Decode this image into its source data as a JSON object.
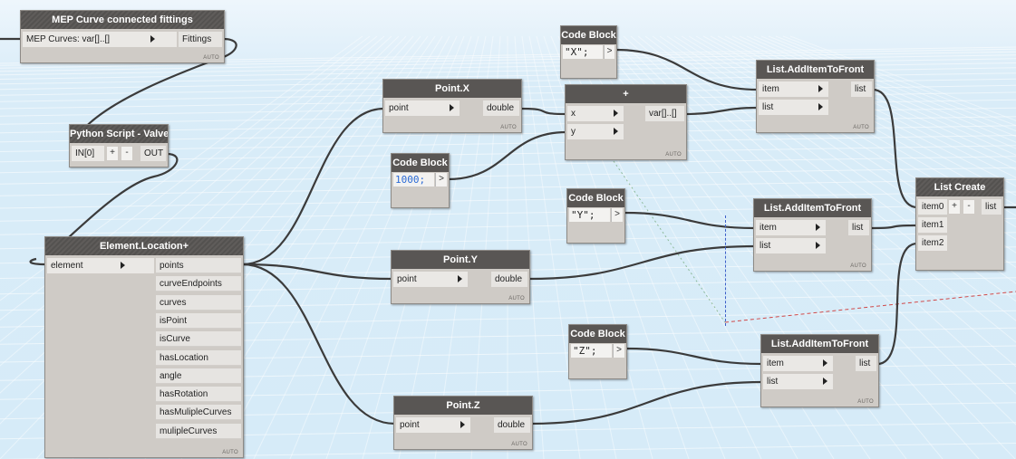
{
  "nodes": {
    "mep": {
      "title": "MEP Curve connected fittings",
      "input": "MEP Curves: var[]..[]",
      "output": "Fittings",
      "lacing": "AUTO"
    },
    "python": {
      "title": "Python Script - Valve",
      "input": "IN[0]",
      "plus": "+",
      "minus": "-",
      "output": "OUT"
    },
    "location": {
      "title": "Element.Location+",
      "input": "element",
      "outputs": [
        "points",
        "curveEndpoints",
        "curves",
        "isPoint",
        "isCurve",
        "hasLocation",
        "angle",
        "hasRotation",
        "hasMulipleCurves",
        "mulipleCurves"
      ],
      "lacing": "AUTO"
    },
    "pointx": {
      "title": "Point.X",
      "input": "point",
      "output": "double",
      "lacing": "AUTO"
    },
    "pointy": {
      "title": "Point.Y",
      "input": "point",
      "output": "double",
      "lacing": "AUTO"
    },
    "pointz": {
      "title": "Point.Z",
      "input": "point",
      "output": "double",
      "lacing": "AUTO"
    },
    "cb_x": {
      "title": "Code Block",
      "code": "\"X\";",
      "out": ">"
    },
    "cb_1000": {
      "title": "Code Block",
      "code": "1000;",
      "out": ">"
    },
    "cb_y": {
      "title": "Code Block",
      "code": "\"Y\";",
      "out": ">"
    },
    "cb_z": {
      "title": "Code Block",
      "code": "\"Z\";",
      "out": ">"
    },
    "plus": {
      "title": "+",
      "inputs": [
        "x",
        "y"
      ],
      "output": "var[]..[]",
      "lacing": "AUTO"
    },
    "add1": {
      "title": "List.AddItemToFront",
      "inputs": [
        "item",
        "list"
      ],
      "output": "list",
      "lacing": "AUTO"
    },
    "add2": {
      "title": "List.AddItemToFront",
      "inputs": [
        "item",
        "list"
      ],
      "output": "list",
      "lacing": "AUTO"
    },
    "add3": {
      "title": "List.AddItemToFront",
      "inputs": [
        "item",
        "list"
      ],
      "output": "list",
      "lacing": "AUTO"
    },
    "listcreate": {
      "title": "List Create",
      "inputs": [
        "item0",
        "item1",
        "item2"
      ],
      "plus": "+",
      "minus": "-",
      "output": "list"
    }
  },
  "colors": {
    "canvas": "#d6ebf8",
    "node_body": "#cfcbc6",
    "node_header": "#595654",
    "wire": "#3b3b3b",
    "code_number": "#2b6bd6"
  }
}
